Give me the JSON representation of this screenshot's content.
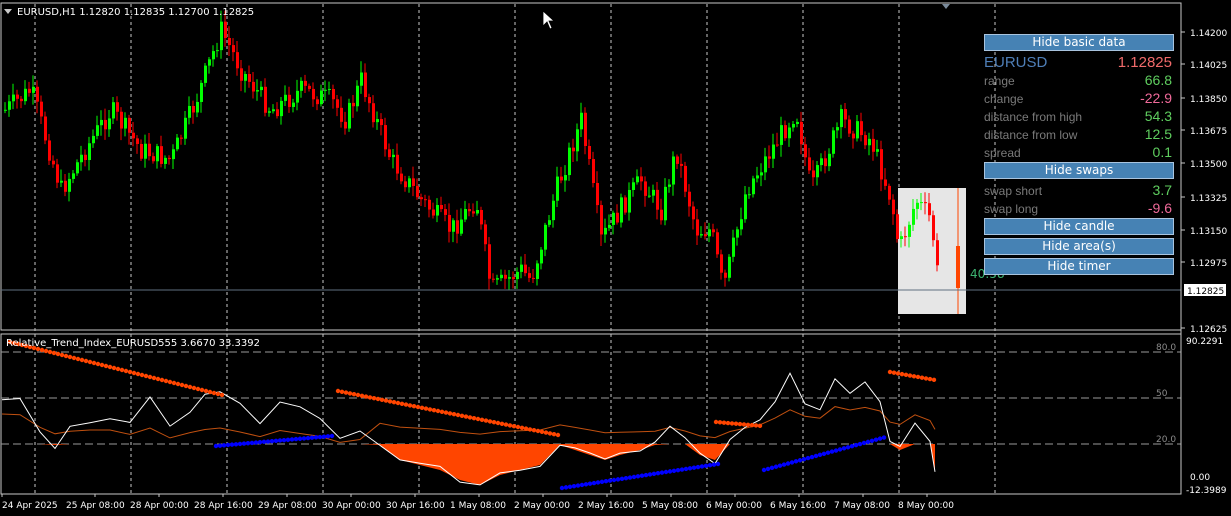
{
  "price_chart": {
    "header": "EURUSD,H1  1.12820 1.12835 1.12700 1.12825",
    "price_labels": [
      "1.14200",
      "1.14025",
      "1.13850",
      "1.13675",
      "1.13500",
      "1.13325",
      "1.13150",
      "1.12975",
      "1.12800",
      "1.12625"
    ],
    "current_price": "1.12825",
    "timer_text": "40:58",
    "bull_color": "#00ff00",
    "bear_color": "#ff0000"
  },
  "indicator": {
    "header": "Relative_Trend_Index_EURUSD555 3.6670 33.3392",
    "levels": [
      "80.0",
      "50",
      "20.0"
    ],
    "scale_top": "90.2291",
    "scale_zero": "0.00",
    "scale_bottom": "-12.3989",
    "fill_color": "#ff4500",
    "trend_up_color": "#0000ff",
    "trend_down_color": "#ff4500"
  },
  "time_labels": [
    "24 Apr 2025",
    "25 Apr 08:00",
    "28 Apr 00:00",
    "28 Apr 16:00",
    "29 Apr 08:00",
    "30 Apr 00:00",
    "30 Apr 16:00",
    "1 May 08:00",
    "2 May 00:00",
    "2 May 16:00",
    "5 May 08:00",
    "6 May 00:00",
    "6 May 16:00",
    "7 May 08:00",
    "8 May 00:00"
  ],
  "panel": {
    "hide_basic_label": "Hide basic data",
    "symbol": "EURUSD",
    "price": "1.12825",
    "rows": [
      {
        "label": "range",
        "value": "66.8",
        "tone": "pos"
      },
      {
        "label": "change",
        "value": "-22.9",
        "tone": "neg"
      },
      {
        "label": "distance from high",
        "value": "54.3",
        "tone": "pos"
      },
      {
        "label": "distance from low",
        "value": "12.5",
        "tone": "pos"
      },
      {
        "label": "spread",
        "value": "0.1",
        "tone": "pos"
      }
    ],
    "hide_swaps_label": "Hide swaps",
    "swaps": [
      {
        "label": "swap short",
        "value": "3.7",
        "tone": "pos"
      },
      {
        "label": "swap long",
        "value": "-9.6",
        "tone": "neg"
      }
    ],
    "hide_candle_label": "Hide candle",
    "hide_areas_label": "Hide area(s)",
    "hide_timer_label": "Hide timer"
  }
}
